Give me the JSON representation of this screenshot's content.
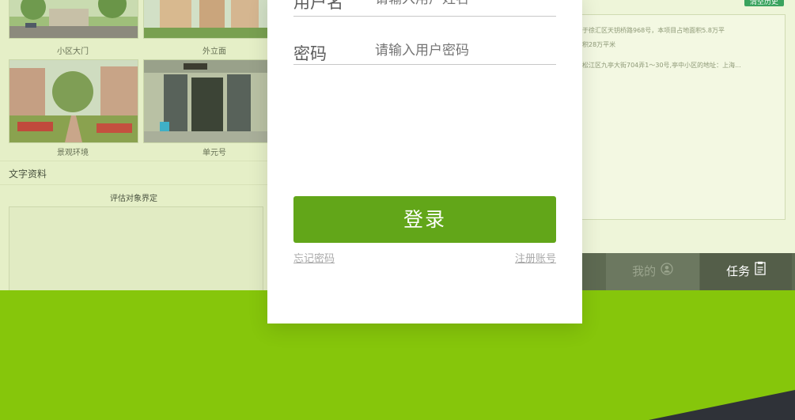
{
  "background_app": {
    "photos": [
      {
        "caption": "小区大门"
      },
      {
        "caption": "外立面"
      },
      {
        "caption": "景观环境"
      },
      {
        "caption": "单元号"
      }
    ],
    "section_title": "文字资料",
    "eval_title": "评估对象界定",
    "clear_history": "清空历史",
    "right_lines": [
      "于徐汇区天钥桥路968号，本项目占地面积5.8万平",
      "积28万平米",
      "松江区九亭大街704弄1～30号,亭中小区的地址：上海..."
    ],
    "tabs": {
      "mine": "我的",
      "task": "任务"
    }
  },
  "login": {
    "username_label": "用户名",
    "username_placeholder": "请输入用户姓名",
    "password_label": "密码",
    "password_placeholder": "请输入用户密码",
    "login_button": "登录",
    "forgot_password": "忘记密码",
    "register": "注册账号"
  },
  "colors": {
    "accent_green": "#62a619",
    "background_green": "#86c60b",
    "dark_corner": "#2f3238"
  }
}
